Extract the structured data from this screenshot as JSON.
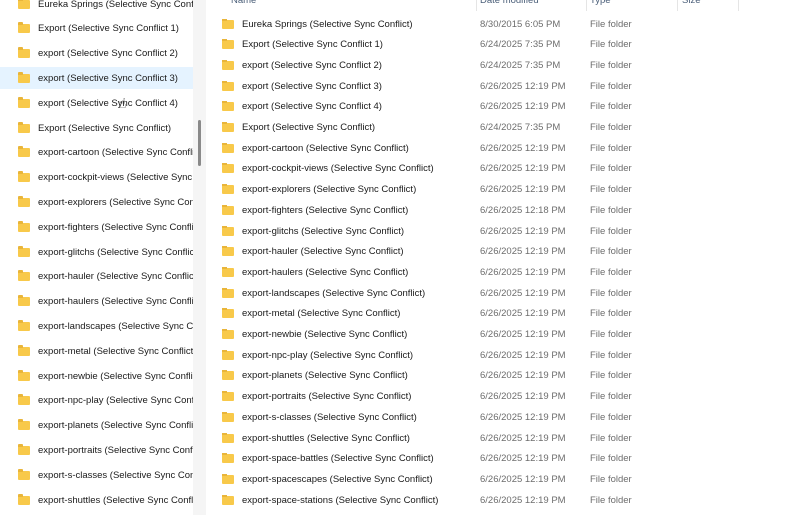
{
  "nav": {
    "selected_index": 3,
    "items": [
      "Eureka Springs (Selective Sync Conflict)",
      "Export (Selective Sync Conflict 1)",
      "export (Selective Sync Conflict 2)",
      "export (Selective Sync Conflict 3)",
      "export (Selective Sync Conflict 4)",
      "Export (Selective Sync Conflict)",
      "export-cartoon (Selective Sync Conflict)",
      "export-cockpit-views (Selective Sync Conflict)",
      "export-explorers (Selective Sync Conflict)",
      "export-fighters (Selective Sync Conflict)",
      "export-glitchs (Selective Sync Conflict)",
      "export-hauler (Selective Sync Conflict)",
      "export-haulers (Selective Sync Conflict)",
      "export-landscapes (Selective Sync Conflict)",
      "export-metal (Selective Sync Conflict)",
      "export-newbie (Selective Sync Conflict)",
      "export-npc-play (Selective Sync Conflict)",
      "export-planets (Selective Sync Conflict)",
      "export-portraits (Selective Sync Conflict)",
      "export-s-classes (Selective Sync Conflict)",
      "export-shuttles (Selective Sync Conflict)"
    ]
  },
  "columns": {
    "name": "Name",
    "date": "Date modified",
    "type": "Type",
    "size": "Size"
  },
  "rows": [
    {
      "name": "Eureka Springs (Selective Sync Conflict)",
      "date": "8/30/2015 6:05 PM",
      "type": "File folder"
    },
    {
      "name": "Export (Selective Sync Conflict 1)",
      "date": "6/24/2025 7:35 PM",
      "type": "File folder"
    },
    {
      "name": "export (Selective Sync Conflict 2)",
      "date": "6/24/2025 7:35 PM",
      "type": "File folder"
    },
    {
      "name": "export (Selective Sync Conflict 3)",
      "date": "6/26/2025 12:19 PM",
      "type": "File folder"
    },
    {
      "name": "export (Selective Sync Conflict 4)",
      "date": "6/26/2025 12:19 PM",
      "type": "File folder"
    },
    {
      "name": "Export (Selective Sync Conflict)",
      "date": "6/24/2025 7:35 PM",
      "type": "File folder"
    },
    {
      "name": "export-cartoon (Selective Sync Conflict)",
      "date": "6/26/2025 12:19 PM",
      "type": "File folder"
    },
    {
      "name": "export-cockpit-views (Selective Sync Conflict)",
      "date": "6/26/2025 12:19 PM",
      "type": "File folder"
    },
    {
      "name": "export-explorers (Selective Sync Conflict)",
      "date": "6/26/2025 12:19 PM",
      "type": "File folder"
    },
    {
      "name": "export-fighters (Selective Sync Conflict)",
      "date": "6/26/2025 12:18 PM",
      "type": "File folder"
    },
    {
      "name": "export-glitchs (Selective Sync Conflict)",
      "date": "6/26/2025 12:19 PM",
      "type": "File folder"
    },
    {
      "name": "export-hauler (Selective Sync Conflict)",
      "date": "6/26/2025 12:19 PM",
      "type": "File folder"
    },
    {
      "name": "export-haulers (Selective Sync Conflict)",
      "date": "6/26/2025 12:19 PM",
      "type": "File folder"
    },
    {
      "name": "export-landscapes (Selective Sync Conflict)",
      "date": "6/26/2025 12:19 PM",
      "type": "File folder"
    },
    {
      "name": "export-metal (Selective Sync Conflict)",
      "date": "6/26/2025 12:19 PM",
      "type": "File folder"
    },
    {
      "name": "export-newbie (Selective Sync Conflict)",
      "date": "6/26/2025 12:19 PM",
      "type": "File folder"
    },
    {
      "name": "export-npc-play (Selective Sync Conflict)",
      "date": "6/26/2025 12:19 PM",
      "type": "File folder"
    },
    {
      "name": "export-planets (Selective Sync Conflict)",
      "date": "6/26/2025 12:19 PM",
      "type": "File folder"
    },
    {
      "name": "export-portraits (Selective Sync Conflict)",
      "date": "6/26/2025 12:19 PM",
      "type": "File folder"
    },
    {
      "name": "export-s-classes (Selective Sync Conflict)",
      "date": "6/26/2025 12:19 PM",
      "type": "File folder"
    },
    {
      "name": "export-shuttles (Selective Sync Conflict)",
      "date": "6/26/2025 12:19 PM",
      "type": "File folder"
    },
    {
      "name": "export-space-battles (Selective Sync Conflict)",
      "date": "6/26/2025 12:19 PM",
      "type": "File folder"
    },
    {
      "name": "export-spacescapes (Selective Sync Conflict)",
      "date": "6/26/2025 12:19 PM",
      "type": "File folder"
    },
    {
      "name": "export-space-stations (Selective Sync Conflict)",
      "date": "6/26/2025 12:19 PM",
      "type": "File folder"
    }
  ]
}
